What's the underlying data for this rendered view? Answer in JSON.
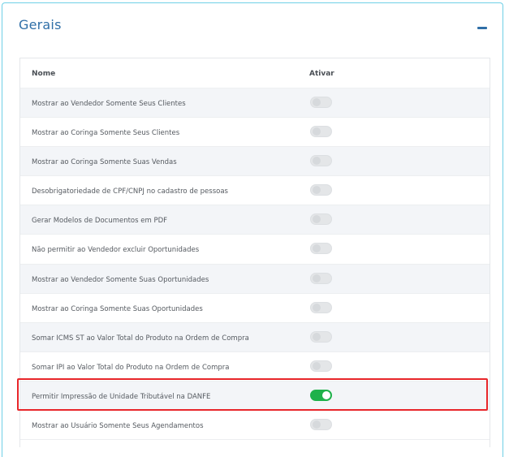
{
  "section": {
    "title": "Gerais",
    "collapse_icon": "minus-icon"
  },
  "table": {
    "headers": {
      "nome": "Nome",
      "ativar": "Ativar"
    },
    "rows": [
      {
        "label": "Mostrar ao Vendedor Somente Seus Clientes",
        "active": false
      },
      {
        "label": "Mostrar ao Coringa Somente Seus Clientes",
        "active": false
      },
      {
        "label": "Mostrar ao Coringa Somente Suas Vendas",
        "active": false
      },
      {
        "label": "Desobrigatoriedade de CPF/CNPJ no cadastro de pessoas",
        "active": false
      },
      {
        "label": "Gerar Modelos de Documentos em PDF",
        "active": false
      },
      {
        "label": "Não permitir ao Vendedor excluir Oportunidades",
        "active": false
      },
      {
        "label": "Mostrar ao Vendedor Somente Suas Oportunidades",
        "active": false
      },
      {
        "label": "Mostrar ao Coringa Somente Suas Oportunidades",
        "active": false
      },
      {
        "label": "Somar ICMS ST ao Valor Total do Produto na Ordem de Compra",
        "active": false
      },
      {
        "label": "Somar IPI ao Valor Total do Produto na Ordem de Compra",
        "active": false
      },
      {
        "label": "Permitir Impressão de Unidade Tributável na DANFE",
        "active": true
      },
      {
        "label": "Mostrar ao Usuário Somente Seus Agendamentos",
        "active": false
      }
    ]
  },
  "colors": {
    "accent": "#2f6fa7",
    "toggle_on": "#1fb14a",
    "highlight": "#e8262a"
  }
}
